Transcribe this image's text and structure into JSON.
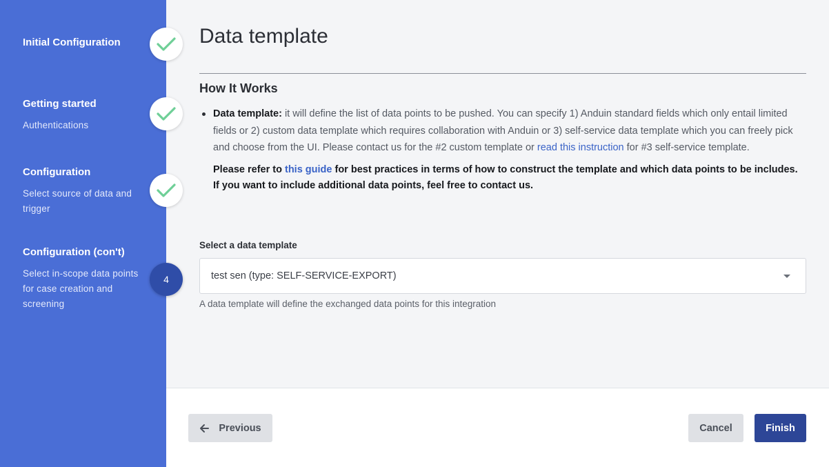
{
  "sidebar": {
    "steps": [
      {
        "title": "Initial Configuration",
        "subtitle": "",
        "status": "done"
      },
      {
        "title": "Getting started",
        "subtitle": "Authentications",
        "status": "done"
      },
      {
        "title": "Configuration",
        "subtitle": "Select source of data and trigger",
        "status": "done"
      },
      {
        "title": "Configuration (con't)",
        "subtitle": "Select in-scope data points for case creation and screening",
        "status": "current",
        "number": "4"
      }
    ],
    "icons": {
      "done": "check-icon"
    },
    "colors": {
      "background": "#4a6ed6",
      "check": "#6fcf97",
      "current_badge": "#2f4da8"
    }
  },
  "main": {
    "title": "Data template",
    "section_title": "How It Works",
    "info": {
      "bold_label": "Data template:",
      "text_1": " it will define the list of data points to be pushed. You can specify 1) Anduin standard fields which only entail limited fields or 2) custom data template which requires collaboration with Anduin or 3) self-service data template which you can freely pick and choose from the UI. Please contact us for the #2 custom template or ",
      "link_1": "read this instruction",
      "text_2": " for #3 self-service template.",
      "note_prefix": "Please refer to ",
      "note_link": "this guide",
      "note_suffix": " for best practices in terms of how to construct the template and which data points to be includes. If you want to include additional data points, feel free to contact us."
    },
    "select": {
      "label": "Select a data template",
      "value": "test sen (type: SELF-SERVICE-EXPORT)",
      "helper": "A data template will define the exchanged data points for this integration"
    }
  },
  "footer": {
    "previous_label": "Previous",
    "cancel_label": "Cancel",
    "finish_label": "Finish",
    "colors": {
      "finish": "#2d4697",
      "secondary": "#dfe1e5"
    }
  }
}
